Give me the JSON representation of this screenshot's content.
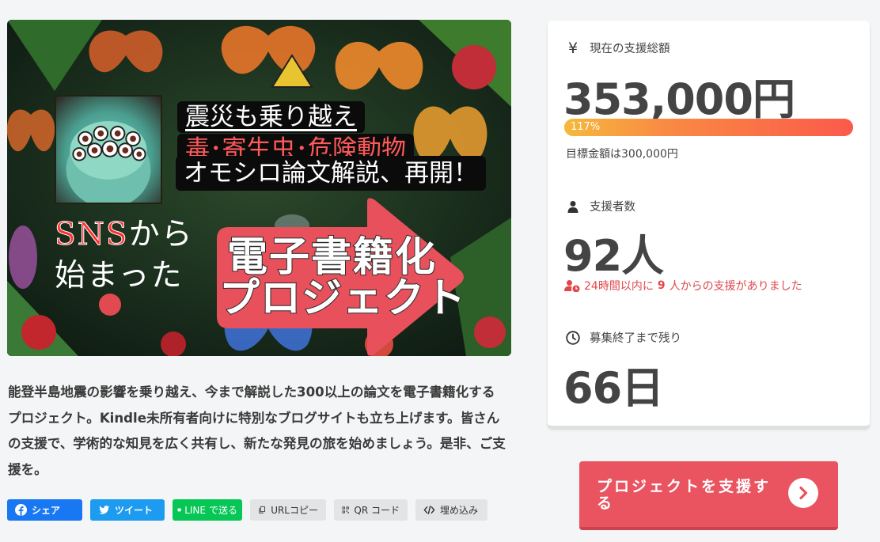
{
  "hero": {
    "caption_line1": "震災も乗り越え",
    "caption_line2": "毒･寄生虫･危険動物",
    "caption_line3": "オモシロ論文解説、再開！",
    "sns_line1_red": "SNS",
    "sns_line1_rest": "から",
    "sns_line2": "始まった",
    "big_line1": "電子書籍化",
    "big_line2": "プロジェクト"
  },
  "description": "能登半島地震の影響を乗り越え、今まで解説した300以上の論文を電子書籍化するプロジェクト。Kindle未所有者向けに特別なブログサイトも立ち上げます。皆さんの支援で、学術的な知見を広く共有し、新たな発見の旅を始めましょう。是非、ご支援を。",
  "share": {
    "facebook": "シェア",
    "twitter": "ツイート",
    "line_logo": "LINE",
    "line": "で送る",
    "url_copy": "URLコピー",
    "qr": "QR コード",
    "embed": "埋め込み"
  },
  "stats": {
    "total_icon": "¥",
    "total_label": "現在の支援総額",
    "total_value": "353,000円",
    "progress_text": "117%",
    "progress": 1.17,
    "goal_text": "目標金額は300,000円",
    "supporters_label": "支援者数",
    "supporters_value": "92人",
    "recent_prefix": "24時間以内に",
    "recent_count": "9",
    "recent_suffix": "人からの支援がありました",
    "remaining_label": "募集終了まで残り",
    "remaining_value": "66日"
  },
  "cta": {
    "label": "プロジェクトを支援する"
  },
  "colors": {
    "accent": "#e95460",
    "facebook": "#1877f2",
    "twitter": "#1d9bf0",
    "line": "#06c755",
    "progress_start": "#f6b93b",
    "progress_end": "#fb5a4a",
    "alert": "#e0474c"
  }
}
